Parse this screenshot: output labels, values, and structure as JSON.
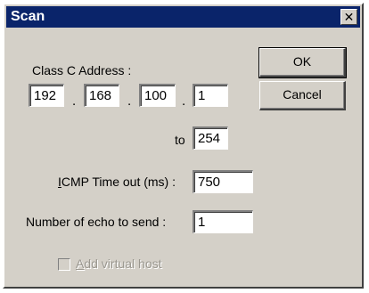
{
  "window": {
    "title": "Scan",
    "close_glyph": "✕"
  },
  "form": {
    "class_c_label": "Class C Address :",
    "ip": [
      "192",
      "168",
      "100",
      "1"
    ],
    "separator": ".",
    "to_label": "to",
    "to_value": "254",
    "icmp_label_prefix": "",
    "icmp_label_mnemonic": "I",
    "icmp_label_rest": "CMP Time out (ms) :",
    "icmp_value": "750",
    "echo_label": "Number of echo to send :",
    "echo_value": "1",
    "virtual_host_mnemonic": "A",
    "virtual_host_rest": "dd virtual host",
    "virtual_host_checked": false
  },
  "buttons": {
    "ok_label": "OK",
    "cancel_label": "Cancel"
  },
  "colors": {
    "titlebar": "#0a246a",
    "face": "#d4d0c8"
  }
}
